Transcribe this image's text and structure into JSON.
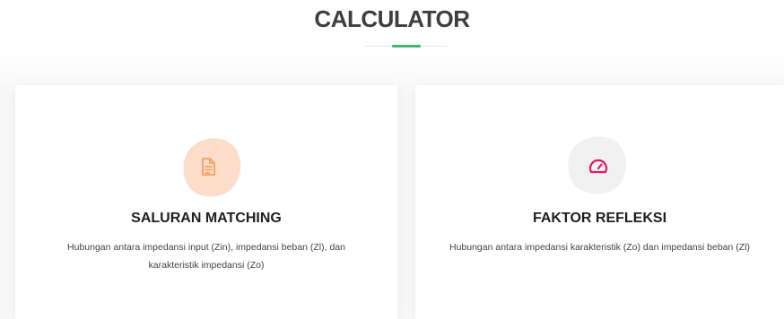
{
  "section": {
    "title": "CALCULATOR"
  },
  "cards": [
    {
      "title": "SALURAN MATCHING",
      "description": "Hubungan antara impedansi input (Zin), impedansi beban (Zl), dan karakteristik impedansi (Zo)",
      "icon": "document-icon",
      "icon_color": "#f6a56c",
      "blob_color": "#fbddc9"
    },
    {
      "title": "FAKTOR REFLEKSI",
      "description": "Hubungan antara impedansi karakteristik (Zo) dan impedansi beban (Zl)",
      "icon": "speedometer-icon",
      "icon_color": "#e5176b",
      "blob_color": "#f1f1f1"
    }
  ],
  "colors": {
    "accent": "#47b475",
    "title": "#3e3e3e"
  }
}
